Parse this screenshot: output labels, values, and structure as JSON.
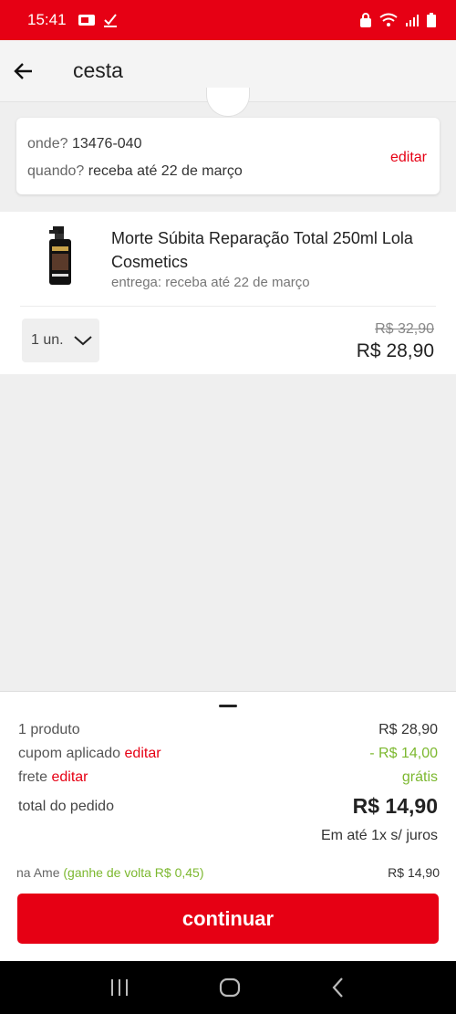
{
  "status_bar": {
    "time": "15:41",
    "icons": [
      "sim-card-icon",
      "check-icon",
      "lock-icon",
      "wifi-icon",
      "signal-icon",
      "battery-icon"
    ]
  },
  "header": {
    "title": "cesta",
    "back_icon": "arrow-left-icon"
  },
  "delivery": {
    "where_label": "onde?",
    "where_value": "13476-040",
    "when_label": "quando?",
    "when_value": "receba até 22 de março",
    "edit_label": "editar"
  },
  "product": {
    "name": "Morte Súbita Reparação Total 250ml Lola Cosmetics",
    "delivery": "entrega: receba até 22 de março",
    "quantity": "1 un.",
    "price_old": "R$ 32,90",
    "price_now": "R$ 28,90"
  },
  "summary": {
    "products_label": "1 produto",
    "products_value": "R$ 28,90",
    "coupon_label": "cupom aplicado",
    "coupon_edit": "editar",
    "coupon_value": "- R$ 14,00",
    "shipping_label": "frete",
    "shipping_edit": "editar",
    "shipping_value": "grátis",
    "total_label": "total do pedido",
    "total_value": "R$ 14,90",
    "installments": "Em até 1x s/ juros",
    "ame_label": "na Ame",
    "ame_cashback": "(ganhe de volta R$ 0,45)",
    "ame_price": "R$ 14,90",
    "continue_label": "continuar"
  },
  "colors": {
    "accent": "#e60014",
    "green": "#7cb82f"
  }
}
